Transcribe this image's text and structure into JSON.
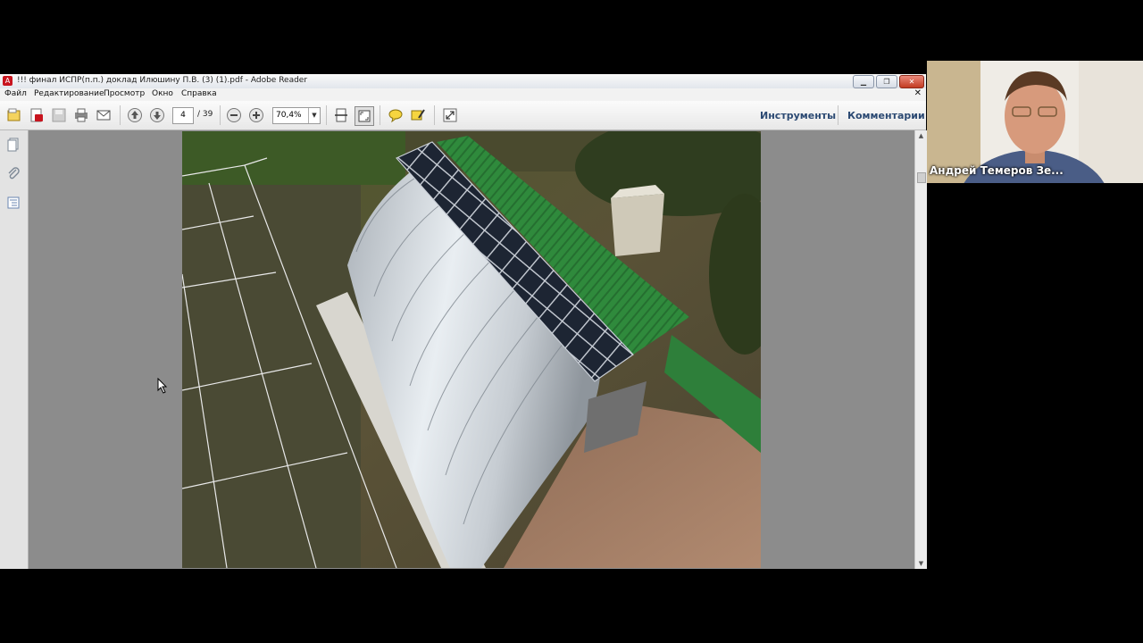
{
  "window": {
    "title": "!!! финал ИСПР(п.п.) доклад Илюшину П.В.  (3) (1).pdf - Adobe Reader",
    "app_icon": "adobe-reader-icon"
  },
  "menu": {
    "items": [
      "Файл",
      "Редактирование",
      "Просмотр",
      "Окно",
      "Справка"
    ]
  },
  "toolbar": {
    "current_page": "4",
    "page_count": "/ 39",
    "zoom": "70,4%",
    "tools_label": "Инструменты",
    "comments_label": "Комментарии"
  },
  "participant": {
    "name": "Андрей Темеров Зе..."
  },
  "colors": {
    "toolbar_link": "#2c4a73",
    "doc_background": "#8c8c8c",
    "window_close": "#c23b22"
  }
}
